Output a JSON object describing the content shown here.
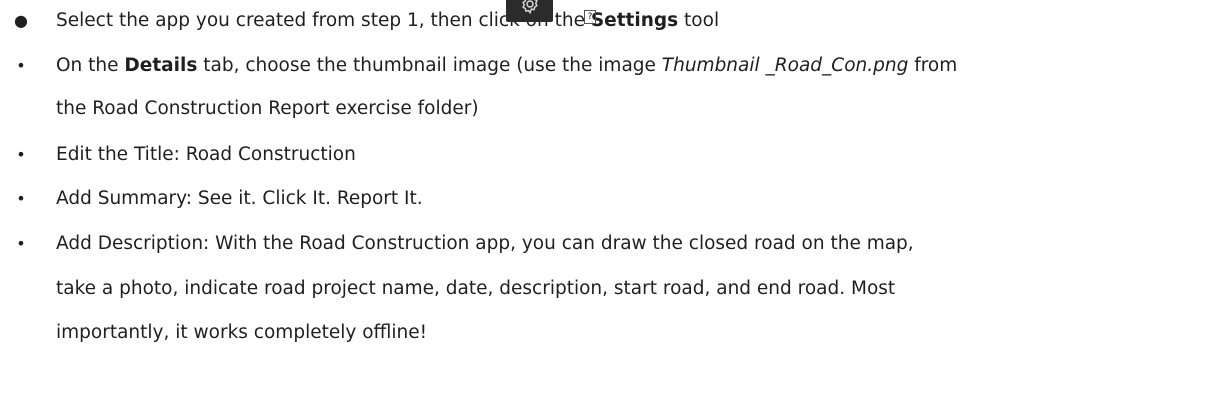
{
  "steps": [
    {
      "pre": "Select the app you created from step 1, then click on the ",
      "bold": "Settings",
      "post": " tool",
      "icon": "gear-icon",
      "glyph": "?"
    },
    {
      "pre": "On the ",
      "bold": "Details",
      "mid": " tab, choose the thumbnail image (use the image ",
      "italic": "Thumbnail _Road_Con.png",
      "post": " from"
    },
    {
      "text": "the Road Construction Report exercise folder)"
    },
    {
      "text": "Edit the Title: Road Construction"
    },
    {
      "text": "Add Summary: See it. Click It. Report It."
    },
    {
      "text": "Add Description: With the Road Construction app, you can draw the closed road on the map,"
    },
    {
      "text": "take a photo, indicate road project name, date, description, start road, and end road. Most"
    },
    {
      "text": "importantly, it works completely offline!"
    }
  ]
}
